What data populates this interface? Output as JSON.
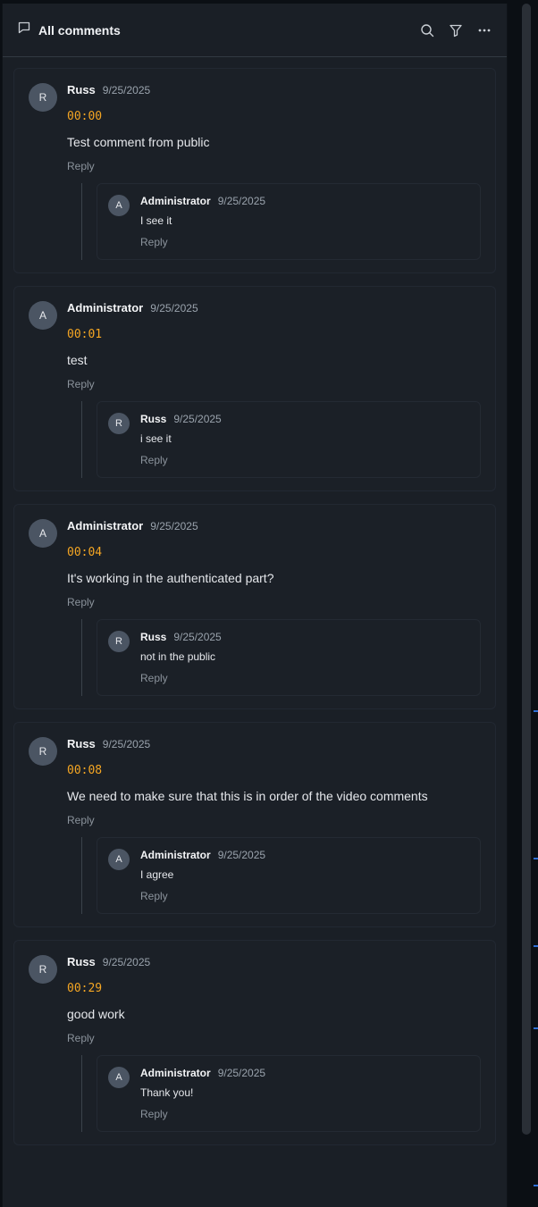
{
  "header": {
    "title": "All comments",
    "icons": [
      "comment-icon",
      "search-icon",
      "filter-icon",
      "more-icon"
    ]
  },
  "comments": [
    {
      "initial": "R",
      "author": "Russ",
      "date": "9/25/2025",
      "timestamp": "00:00",
      "text": "Test comment from public",
      "reply_label": "Reply",
      "reply": {
        "initial": "A",
        "author": "Administrator",
        "date": "9/25/2025",
        "text": "I see it",
        "reply_label": "Reply"
      }
    },
    {
      "initial": "A",
      "author": "Administrator",
      "date": "9/25/2025",
      "timestamp": "00:01",
      "text": "test",
      "reply_label": "Reply",
      "reply": {
        "initial": "R",
        "author": "Russ",
        "date": "9/25/2025",
        "text": "i see it",
        "reply_label": "Reply"
      }
    },
    {
      "initial": "A",
      "author": "Administrator",
      "date": "9/25/2025",
      "timestamp": "00:04",
      "text": "It's working in the authenticated part?",
      "reply_label": "Reply",
      "reply": {
        "initial": "R",
        "author": "Russ",
        "date": "9/25/2025",
        "text": "not in the public",
        "reply_label": "Reply"
      }
    },
    {
      "initial": "R",
      "author": "Russ",
      "date": "9/25/2025",
      "timestamp": "00:08",
      "text": "We need to make sure that this is in order of the video comments",
      "reply_label": "Reply",
      "reply": {
        "initial": "A",
        "author": "Administrator",
        "date": "9/25/2025",
        "text": "I agree",
        "reply_label": "Reply"
      }
    },
    {
      "initial": "R",
      "author": "Russ",
      "date": "9/25/2025",
      "timestamp": "00:29",
      "text": "good work",
      "reply_label": "Reply",
      "reply": {
        "initial": "A",
        "author": "Administrator",
        "date": "9/25/2025",
        "text": "Thank you!",
        "reply_label": "Reply"
      }
    }
  ]
}
